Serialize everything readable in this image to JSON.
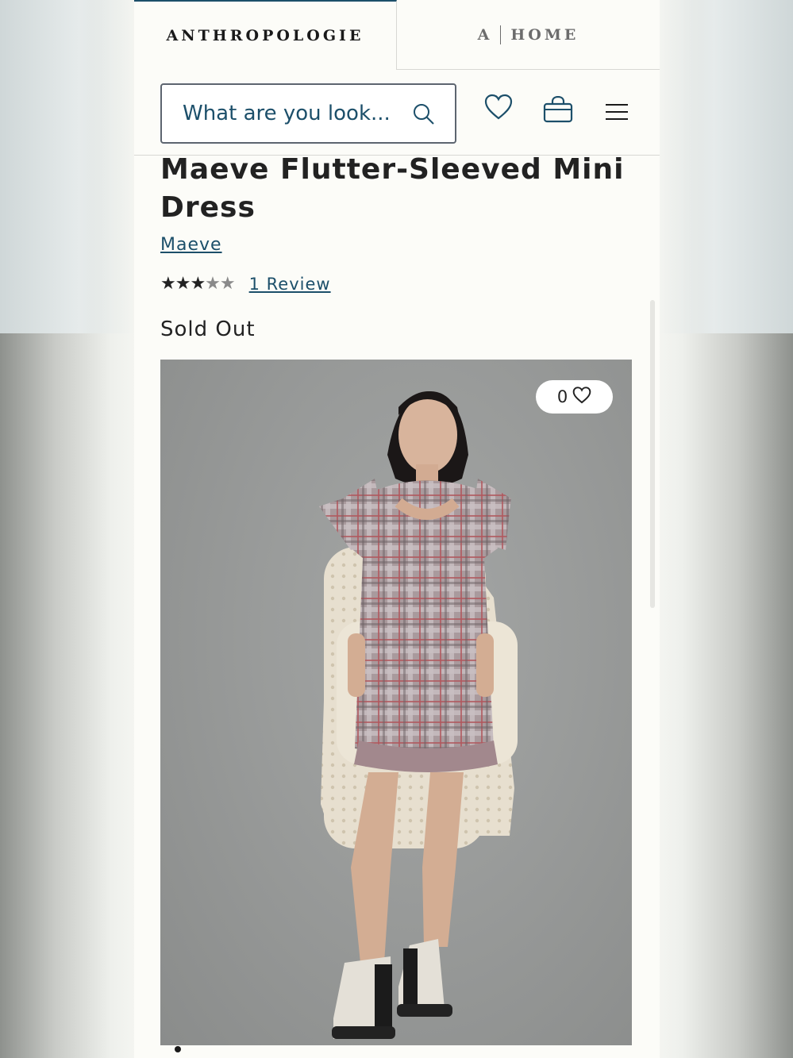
{
  "tabs": {
    "main": "ANTHROPOLOGIE",
    "home_mark": "A",
    "home": "HOME"
  },
  "search": {
    "placeholder": "What are you look..."
  },
  "icons": {
    "search": "search-icon",
    "wishlist": "heart-icon",
    "bag": "shopping-bag-icon",
    "menu": "hamburger-menu-icon"
  },
  "product": {
    "title": "Maeve Flutter-Sleeved Mini Dress",
    "brand": "Maeve",
    "rating": 3,
    "rating_max": 5,
    "stars_on": "★★★",
    "stars_off": "★★",
    "reviews_label": "1 Review",
    "status": "Sold Out",
    "wishlist_count": "0"
  },
  "gallery": {
    "current": 1
  },
  "colors": {
    "accent": "#1c4f6a",
    "text": "#222222"
  }
}
